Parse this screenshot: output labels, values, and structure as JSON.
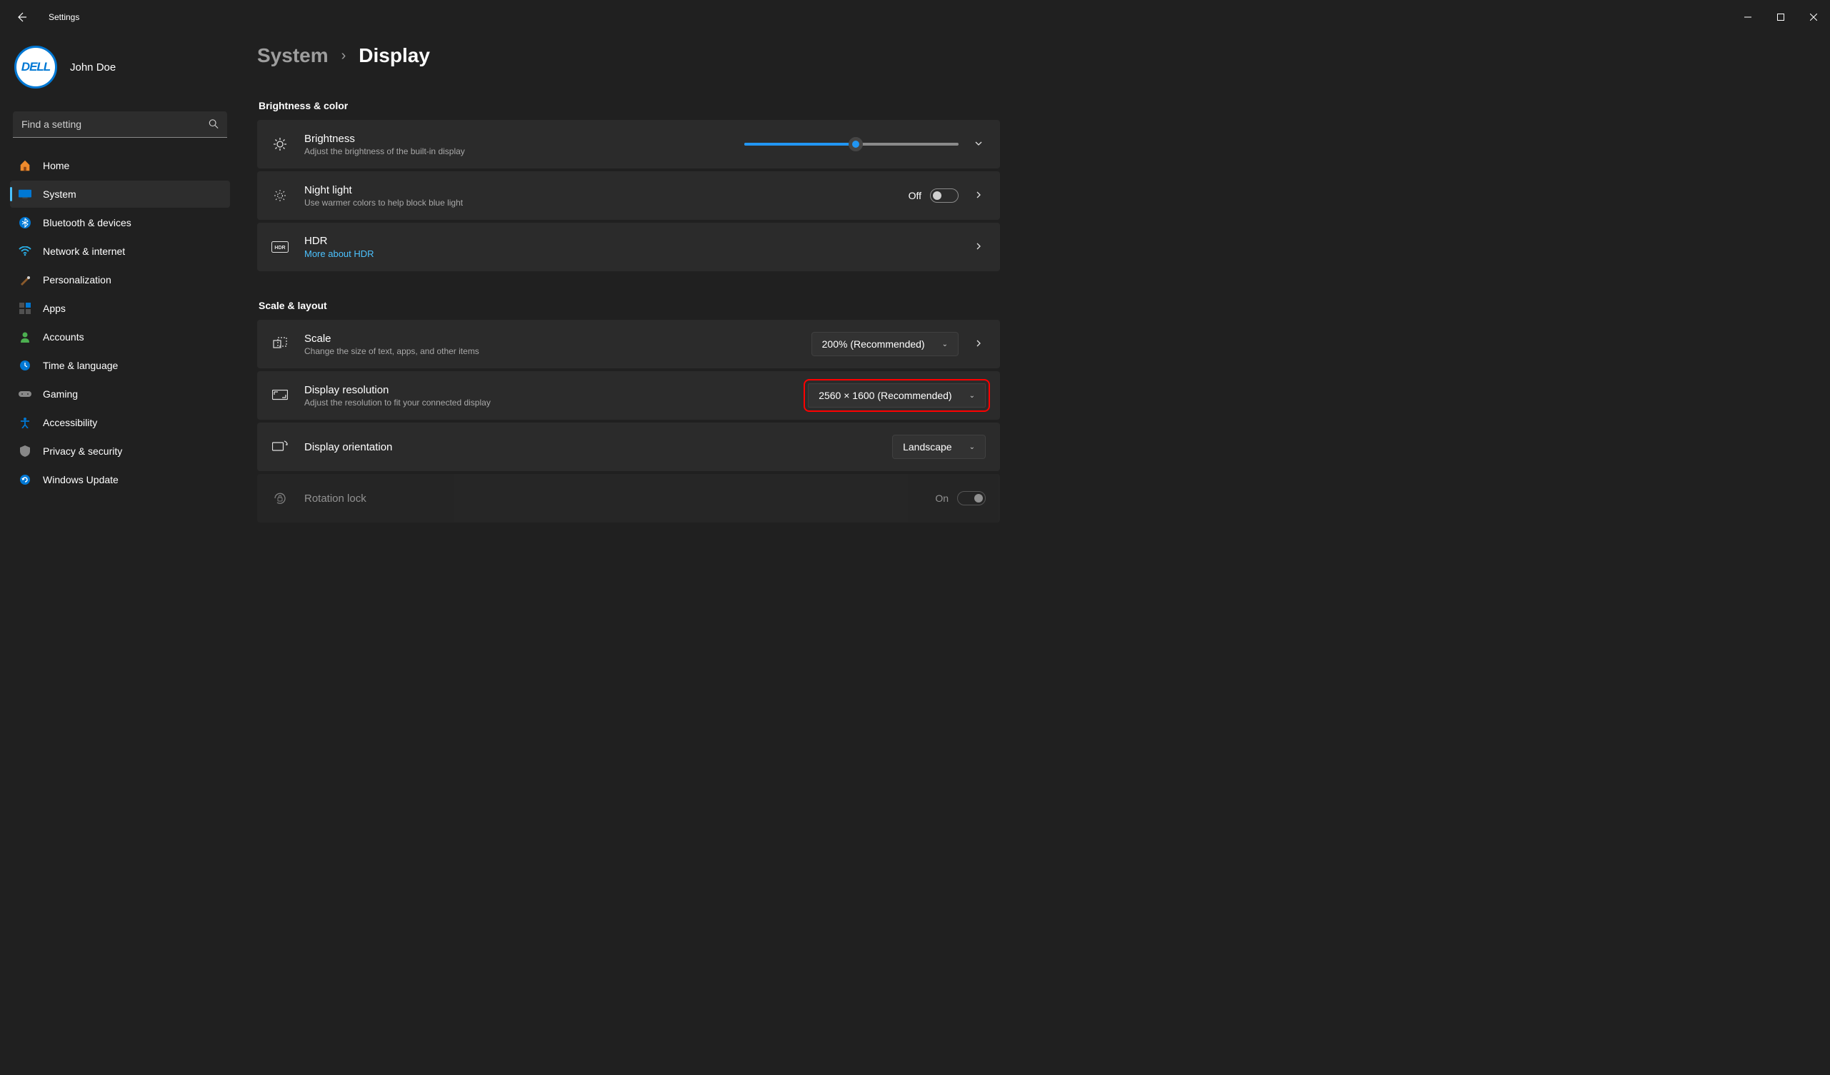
{
  "app_title": "Settings",
  "user": {
    "name": "John Doe",
    "avatar_text": "DELL"
  },
  "search": {
    "placeholder": "Find a setting"
  },
  "nav": [
    {
      "label": "Home",
      "active": false
    },
    {
      "label": "System",
      "active": true
    },
    {
      "label": "Bluetooth & devices",
      "active": false
    },
    {
      "label": "Network & internet",
      "active": false
    },
    {
      "label": "Personalization",
      "active": false
    },
    {
      "label": "Apps",
      "active": false
    },
    {
      "label": "Accounts",
      "active": false
    },
    {
      "label": "Time & language",
      "active": false
    },
    {
      "label": "Gaming",
      "active": false
    },
    {
      "label": "Accessibility",
      "active": false
    },
    {
      "label": "Privacy & security",
      "active": false
    },
    {
      "label": "Windows Update",
      "active": false
    }
  ],
  "breadcrumb": {
    "parent": "System",
    "current": "Display"
  },
  "sections": {
    "brightness_color": {
      "title": "Brightness & color",
      "brightness": {
        "title": "Brightness",
        "sub": "Adjust the brightness of the built-in display",
        "value_pct": 52
      },
      "night_light": {
        "title": "Night light",
        "sub": "Use warmer colors to help block blue light",
        "state": "Off"
      },
      "hdr": {
        "title": "HDR",
        "link": "More about HDR"
      }
    },
    "scale_layout": {
      "title": "Scale & layout",
      "scale": {
        "title": "Scale",
        "sub": "Change the size of text, apps, and other items",
        "value": "200% (Recommended)"
      },
      "resolution": {
        "title": "Display resolution",
        "sub": "Adjust the resolution to fit your connected display",
        "value": "2560 × 1600 (Recommended)"
      },
      "orientation": {
        "title": "Display orientation",
        "value": "Landscape"
      },
      "rotation_lock": {
        "title": "Rotation lock",
        "state": "On"
      }
    }
  }
}
